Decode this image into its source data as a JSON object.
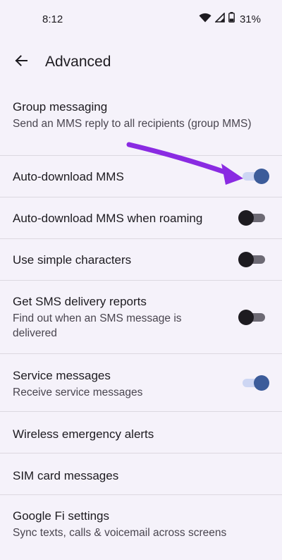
{
  "status_bar": {
    "time": "8:12",
    "battery": "31%",
    "icons": [
      "wifi-icon",
      "signal-icon",
      "battery-icon"
    ]
  },
  "app_bar": {
    "back_icon": "arrow-back-icon",
    "title": "Advanced"
  },
  "settings": [
    {
      "title": "Group messaging",
      "subtitle": "Send an MMS reply to all recipients (group MMS)"
    },
    {
      "title": "Auto-download MMS",
      "toggle": true
    },
    {
      "title": "Auto-download MMS when roaming",
      "toggle": false
    },
    {
      "title": "Use simple characters",
      "toggle": false
    },
    {
      "title": "Get SMS delivery reports",
      "subtitle": "Find out when an SMS message is delivered",
      "toggle": false
    },
    {
      "title": "Service messages",
      "subtitle": "Receive service messages",
      "toggle": true
    },
    {
      "title": "Wireless emergency alerts"
    },
    {
      "title": "SIM card messages"
    },
    {
      "title": "Google Fi settings",
      "subtitle": "Sync texts, calls & voicemail across screens"
    }
  ],
  "colors": {
    "background": "#f5f2fa",
    "toggle_on_thumb": "#3c5c9a",
    "toggle_on_track": "#cdd6f3",
    "toggle_off_thumb": "#1d1b20",
    "annotation_arrow": "#8a2be2"
  }
}
